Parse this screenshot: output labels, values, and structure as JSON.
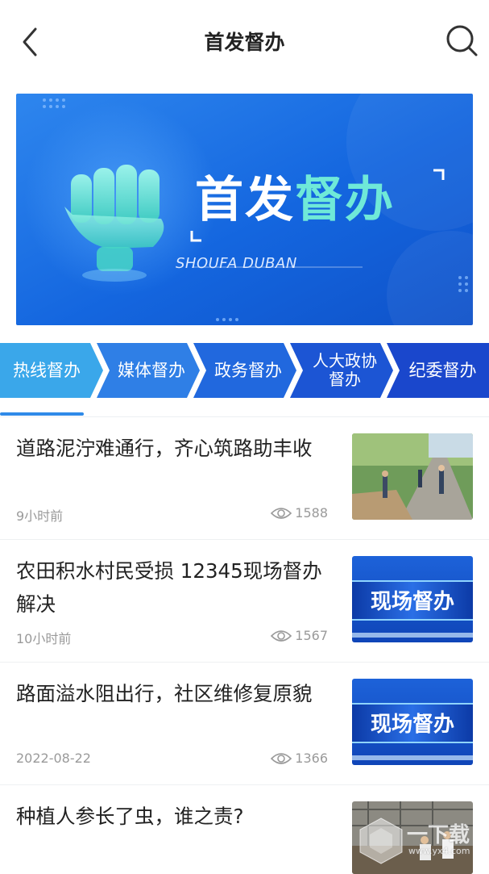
{
  "header": {
    "title": "首发督办"
  },
  "banner": {
    "title_white": "首发",
    "title_green": "督办",
    "subtitle": "SHOUFA DUBAN"
  },
  "tabs": [
    {
      "label": "热线督办",
      "color": "#3aa7ea"
    },
    {
      "label": "媒体督办",
      "color": "#2f7fe6"
    },
    {
      "label": "政务督办",
      "color": "#2168de"
    },
    {
      "label": "人大政协督办",
      "line1": "人大政协",
      "line2": "督办",
      "color": "#1c55d4"
    },
    {
      "label": "纪委督办",
      "color": "#1a47cc"
    }
  ],
  "articles": [
    {
      "title": "道路泥泞难通行，齐心筑路助丰收",
      "time": "9小时前",
      "views": "1588",
      "thumb": "photo-road-work"
    },
    {
      "title": "农田积水村民受损 12345现场督办解决",
      "time": "10小时前",
      "views": "1567",
      "thumb": "现场督办"
    },
    {
      "title": "路面溢水阻出行，社区维修复原貌",
      "time": "2022-08-22",
      "views": "1366",
      "thumb": "现场督办"
    },
    {
      "title": "种植人参长了虫，谁之责?",
      "thumb": "photo-greenhouse"
    }
  ],
  "watermark": {
    "text": "一下载",
    "url": "www.yx4.com"
  },
  "colors": {
    "accent": "#2f8ae8",
    "banner_bg": "#1a6fe0",
    "teal": "#6fe9d8"
  }
}
